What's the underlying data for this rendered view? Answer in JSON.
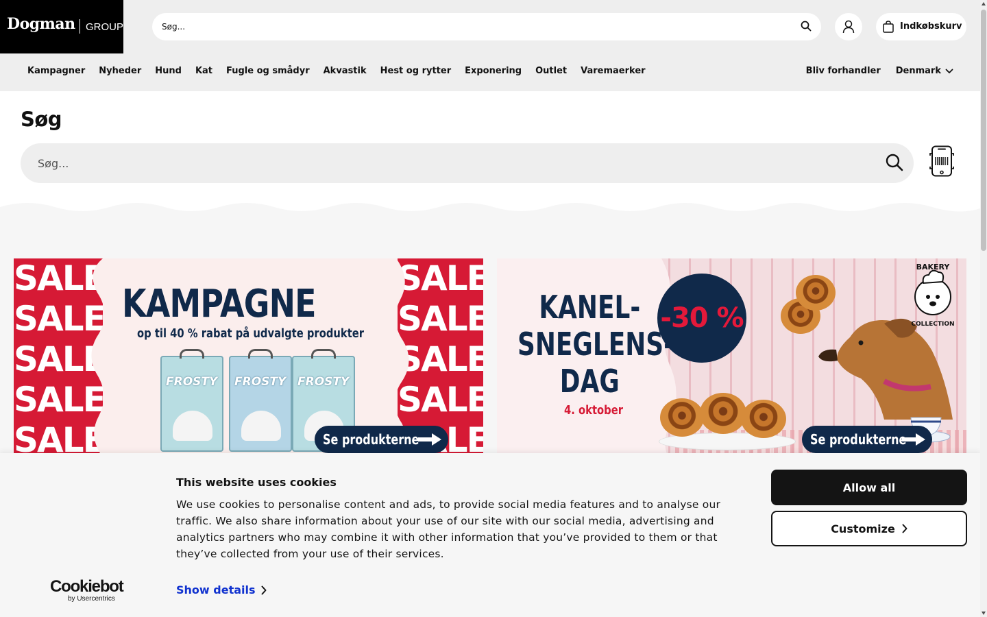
{
  "logo": {
    "brand": "Dogman",
    "group": "GROUP"
  },
  "header": {
    "search_placeholder": "Søg...",
    "cart_label": "Indkøbskurv"
  },
  "nav": {
    "items": [
      "Kampagner",
      "Nyheder",
      "Hund",
      "Kat",
      "Fugle og smådyr",
      "Akvastik",
      "Hest og rytter",
      "Exponering",
      "Outlet",
      "Varemaerker"
    ],
    "become_dealer": "Bliv forhandler",
    "country": "Denmark"
  },
  "search_page": {
    "title": "Søg",
    "placeholder": "Søg..."
  },
  "banners": {
    "left": {
      "sale_word": "SALE",
      "title": "KAMPAGNE",
      "subtitle": "op til 40 % rabat på udvalgte produkter",
      "product_brand": "FROSTY",
      "cta": "Se produkterne"
    },
    "right": {
      "title_line1": "KANEL-",
      "title_line2": "SNEGLENS-",
      "title_line3": "DAG",
      "date": "4. oktober",
      "discount": "-30 %",
      "badge_line1": "BAKERY",
      "badge_line2": "COLLECTION",
      "cta": "Se produkterne"
    }
  },
  "cookie": {
    "title": "This website uses cookies",
    "body": "We use cookies to personalise content and ads, to provide social media features and to analyse our traffic. We also share information about your use of our site with our social media, advertising and analytics partners who may combine it with other information that you’ve provided to them or that they’ve collected from your use of their services.",
    "show_details": "Show details",
    "allow_all": "Allow all",
    "customize": "Customize",
    "provider_name": "Cookiebot",
    "provider_by": "by Usercentrics"
  },
  "colors": {
    "header_bg": "#eeeeee",
    "navy": "#10294a",
    "sale_red": "#d61a35",
    "link_blue": "#1032cf"
  }
}
